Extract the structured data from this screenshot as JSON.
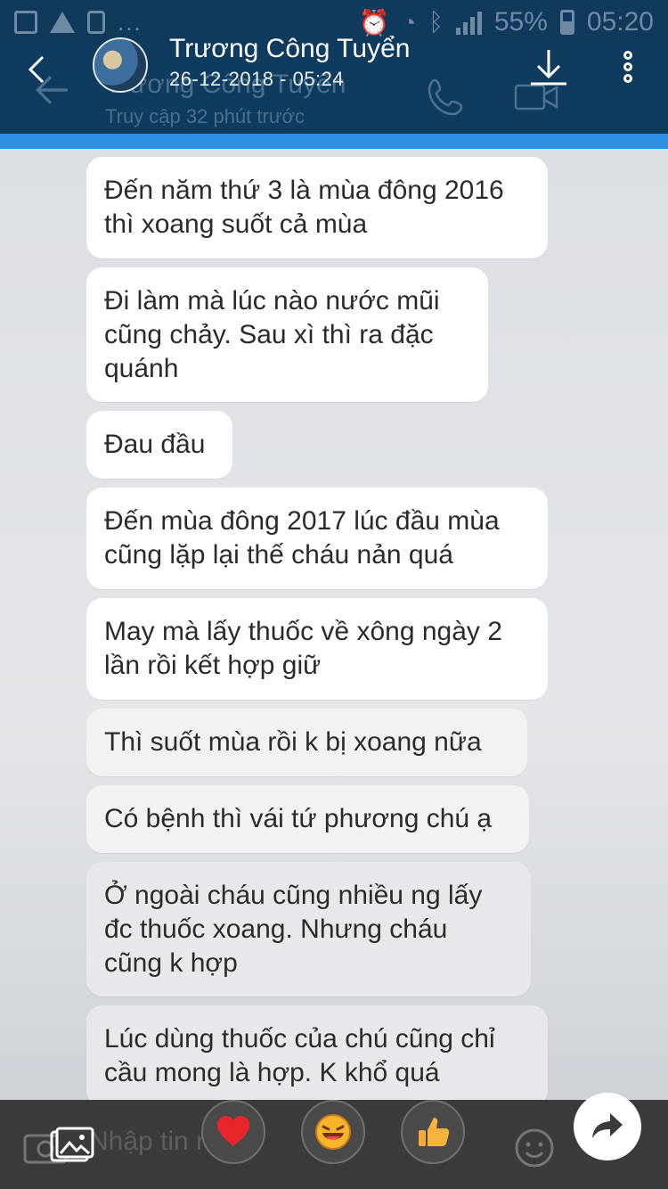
{
  "status_bar": {
    "dots": "...",
    "battery": "55%",
    "time": "05:20"
  },
  "header": {
    "name": "Trương Công Tuyển",
    "date": "26-12-2018 - 05:24",
    "ghost_name": "Trương Công Tuyển",
    "ghost_status": "Truy cập 32 phút trước"
  },
  "messages": [
    {
      "lines": [
        "Đến năm thứ 3 là mùa đông 2016",
        "thì xoang suốt cả mùa"
      ]
    },
    {
      "lines": [
        "Đi làm mà lúc nào nước mũi",
        "cũng chảy. Sau xì thì ra đặc",
        "quánh"
      ]
    },
    {
      "lines": [
        "Đau đầu"
      ]
    },
    {
      "lines": [
        "Đến mùa đông 2017 lúc đầu mùa",
        "cũng lặp lại thế cháu nản quá"
      ]
    },
    {
      "lines": [
        "May mà lấy thuốc về xông ngày 2",
        "lần rồi kết hợp giữ"
      ]
    },
    {
      "lines": [
        "Thì suốt mùa rồi k bị xoang nữa"
      ]
    },
    {
      "lines": [
        "Có bệnh thì vái tứ phương chú ạ"
      ]
    },
    {
      "lines": [
        "Ở ngoài cháu cũng nhiều ng lấy",
        "đc thuốc xoang. Nhưng cháu",
        "cũng k hợp"
      ]
    },
    {
      "lines": [
        "Lúc dùng thuốc của chú cũng chỉ",
        "cầu mong là hợp. K khổ quá"
      ]
    }
  ],
  "bottom_bar": {
    "ghost_placeholder": "Nhập tin nhắn",
    "reactions": [
      "heart-icon",
      "laugh-icon",
      "thumbs-up-icon"
    ]
  },
  "colors": {
    "header_bg": "#0e3b5e",
    "accent_strip": "#2e90e4",
    "bubble_bg": "#ffffff",
    "bottom_bg": "#3b3b3b"
  }
}
